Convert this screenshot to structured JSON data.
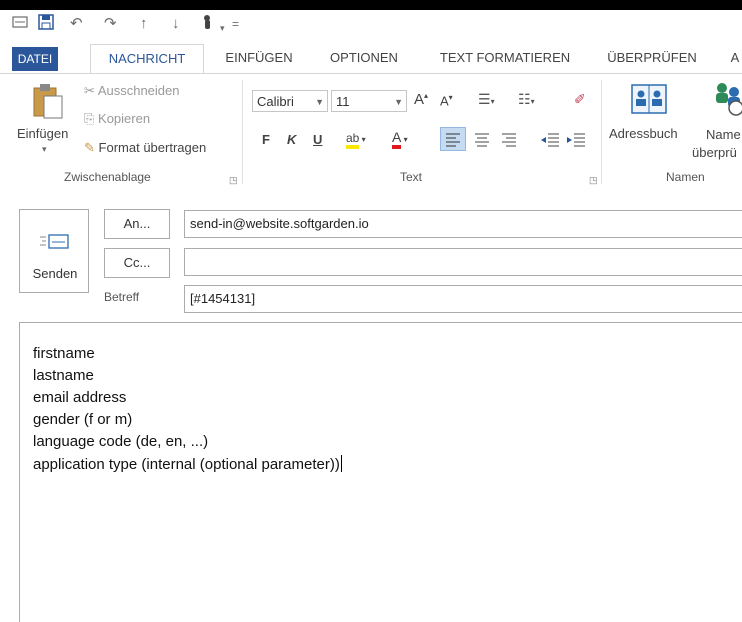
{
  "quick_access": {
    "icons": [
      "mail-icon",
      "save-icon",
      "undo-icon",
      "redo-icon",
      "up-arrow-icon",
      "down-arrow-icon",
      "touch-mode-icon",
      "customize-icon"
    ]
  },
  "tabs": [
    {
      "label": "DATEI"
    },
    {
      "label": "NACHRICHT"
    },
    {
      "label": "EINFÜGEN"
    },
    {
      "label": "OPTIONEN"
    },
    {
      "label": "TEXT FORMATIEREN"
    },
    {
      "label": "ÜBERPRÜFEN"
    },
    {
      "label": "A"
    }
  ],
  "clipboard": {
    "paste_label": "Einfügen",
    "cut_label": "Ausschneiden",
    "copy_label": "Kopieren",
    "format_painter_label": "Format übertragen",
    "group_label": "Zwischenablage"
  },
  "text_group": {
    "font_name": "Calibri",
    "font_size": "11",
    "bold": "F",
    "italic": "K",
    "underline": "U",
    "group_label": "Text"
  },
  "names_group": {
    "address_book_label": "Adressbuch",
    "check_names_line1": "Name",
    "check_names_line2": "überprü",
    "group_label": "Namen"
  },
  "compose": {
    "send_label": "Senden",
    "to_button": "An...",
    "cc_button": "Cc...",
    "subject_label": "Betreff",
    "to_value": "send-in@website.softgarden.io",
    "cc_value": "",
    "subject_value": "[#1454131]",
    "body_lines": [
      "firstname",
      "lastname",
      "email address",
      "gender (f or m)",
      "language code (de, en, ...)",
      "application type (internal (optional parameter))"
    ]
  },
  "colors": {
    "accent": "#2b579a",
    "highlight_yellow": "#ffe800",
    "font_color_red": "#e01a1a"
  }
}
